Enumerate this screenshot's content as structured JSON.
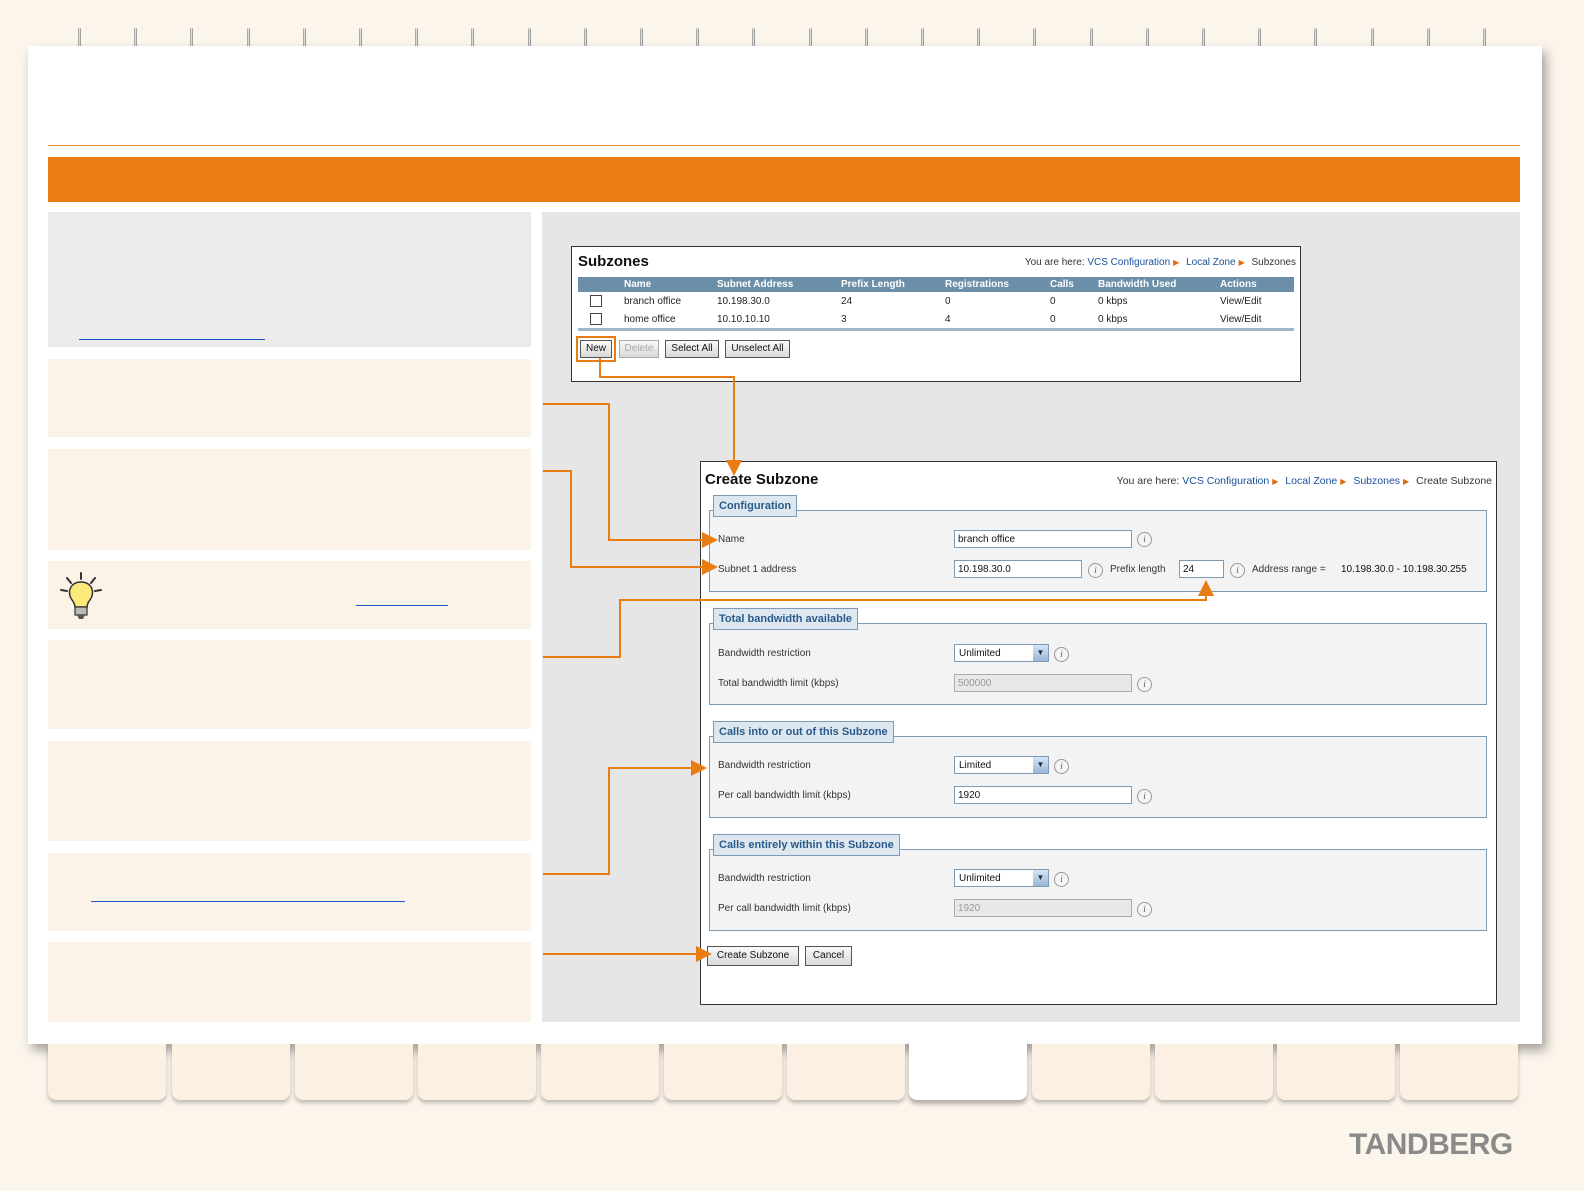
{
  "subzones_window": {
    "title": "Subzones",
    "breadcrumb": {
      "prefix": "You are here:",
      "items": [
        "VCS Configuration",
        "Local Zone"
      ],
      "current": "Subzones"
    },
    "columns": [
      "Name",
      "Subnet Address",
      "Prefix Length",
      "Registrations",
      "Calls",
      "Bandwidth Used",
      "Actions"
    ],
    "rows": [
      {
        "name": "branch office",
        "subnet": "10.198.30.0",
        "prefix": "24",
        "registrations": "0",
        "calls": "0",
        "bandwidth": "0 kbps",
        "action": "View/Edit"
      },
      {
        "name": "home office",
        "subnet": "10.10.10.10",
        "prefix": "3",
        "registrations": "4",
        "calls": "0",
        "bandwidth": "0 kbps",
        "action": "View/Edit"
      }
    ],
    "buttons": {
      "new": "New",
      "delete": "Delete",
      "select_all": "Select All",
      "unselect_all": "Unselect All"
    }
  },
  "create_window": {
    "title": "Create Subzone",
    "breadcrumb": {
      "prefix": "You are here:",
      "items": [
        "VCS Configuration",
        "Local Zone",
        "Subzones"
      ],
      "current": "Create Subzone"
    },
    "configuration": {
      "legend": "Configuration",
      "name_label": "Name",
      "name_value": "branch office",
      "subnet_label": "Subnet 1 address",
      "subnet_value": "10.198.30.0",
      "prefix_label": "Prefix length",
      "prefix_value": "24",
      "range_label": "Address range =",
      "range_value": "10.198.30.0 - 10.198.30.255"
    },
    "total_bandwidth": {
      "legend": "Total bandwidth available",
      "restriction_label": "Bandwidth restriction",
      "restriction_value": "Unlimited",
      "limit_label": "Total bandwidth limit (kbps)",
      "limit_value": "500000"
    },
    "calls_in_out": {
      "legend": "Calls into or out of this Subzone",
      "restriction_label": "Bandwidth restriction",
      "restriction_value": "Limited",
      "limit_label": "Per call bandwidth limit (kbps)",
      "limit_value": "1920"
    },
    "calls_within": {
      "legend": "Calls entirely within this Subzone",
      "restriction_label": "Bandwidth restriction",
      "restriction_value": "Unlimited",
      "limit_label": "Per call bandwidth limit (kbps)",
      "limit_value": "1920"
    },
    "buttons": {
      "create": "Create Subzone",
      "cancel": "Cancel"
    }
  },
  "brand": {
    "logo": "TANDBERG"
  },
  "colors": {
    "accent": "#e97d12",
    "link": "#1a4f9c"
  },
  "icons": {
    "tip": "lightbulb-icon",
    "info": "info-icon",
    "dropdown": "chevron-down-icon"
  }
}
